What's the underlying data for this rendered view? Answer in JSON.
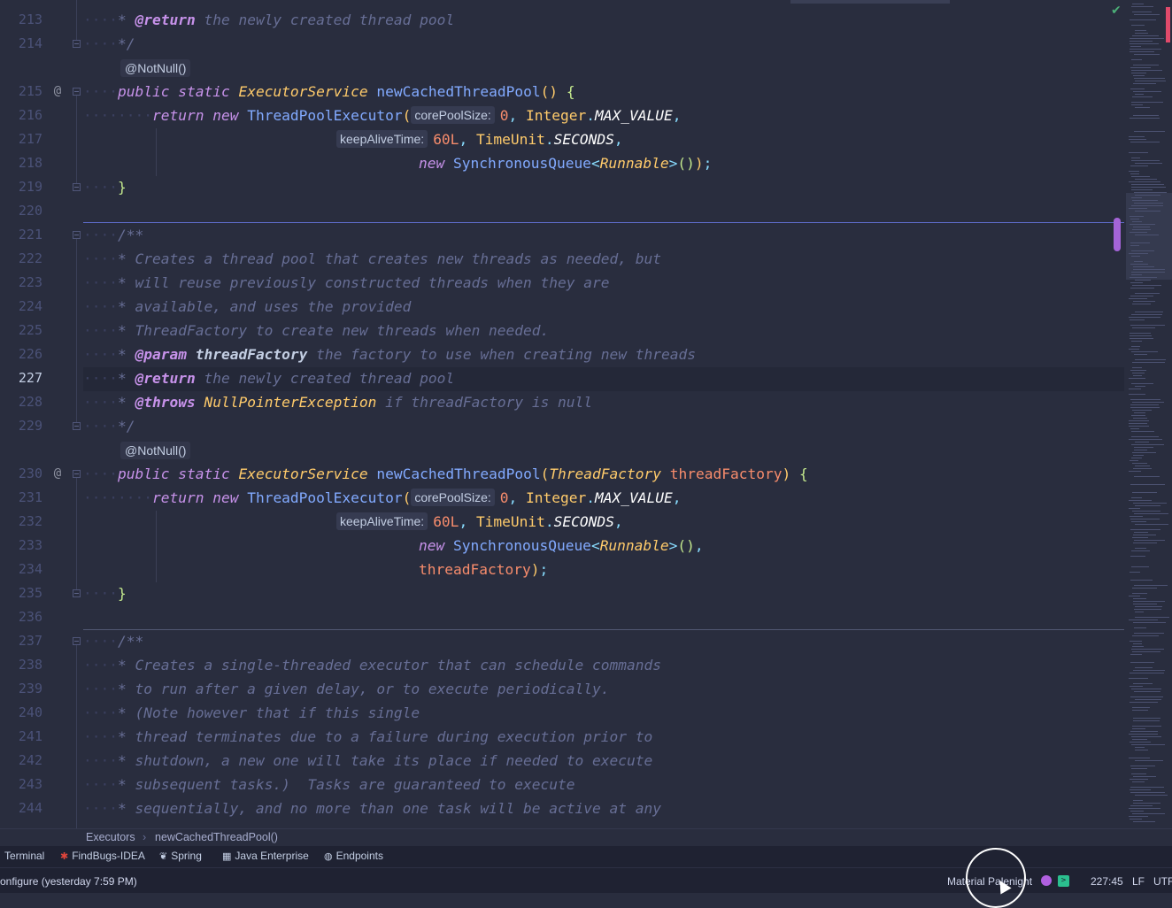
{
  "editor": {
    "current_line": "227",
    "lines": [
      {
        "n": "213",
        "text": "@return the newly created thread pool"
      },
      {
        "n": "214",
        "text": "*/"
      },
      {
        "n": "215",
        "text": "public static ExecutorService newCachedThreadPool() {"
      },
      {
        "n": "216",
        "text": "return new ThreadPoolExecutor(corePoolSize: 0, Integer.MAX_VALUE,"
      },
      {
        "n": "217",
        "text": "keepAliveTime: 60L, TimeUnit.SECONDS,"
      },
      {
        "n": "218",
        "text": "new SynchronousQueue<Runnable>());"
      },
      {
        "n": "219",
        "text": "}"
      },
      {
        "n": "220",
        "text": ""
      },
      {
        "n": "221",
        "text": "/**"
      },
      {
        "n": "222",
        "text": "* Creates a thread pool that creates new threads as needed, but"
      },
      {
        "n": "223",
        "text": "* will reuse previously constructed threads when they are"
      },
      {
        "n": "224",
        "text": "* available, and uses the provided"
      },
      {
        "n": "225",
        "text": "* ThreadFactory to create new threads when needed."
      },
      {
        "n": "226",
        "text": "* @param threadFactory the factory to use when creating new threads"
      },
      {
        "n": "227",
        "text": "* @return the newly created thread pool"
      },
      {
        "n": "228",
        "text": "* @throws NullPointerException if threadFactory is null"
      },
      {
        "n": "229",
        "text": "*/"
      },
      {
        "n": "230",
        "text": "public static ExecutorService newCachedThreadPool(ThreadFactory threadFactory) {"
      },
      {
        "n": "231",
        "text": "return new ThreadPoolExecutor(corePoolSize: 0, Integer.MAX_VALUE,"
      },
      {
        "n": "232",
        "text": "keepAliveTime: 60L, TimeUnit.SECONDS,"
      },
      {
        "n": "233",
        "text": "new SynchronousQueue<Runnable>(),"
      },
      {
        "n": "234",
        "text": "threadFactory);"
      },
      {
        "n": "235",
        "text": "}"
      },
      {
        "n": "236",
        "text": ""
      },
      {
        "n": "237",
        "text": "/**"
      },
      {
        "n": "238",
        "text": "* Creates a single-threaded executor that can schedule commands"
      },
      {
        "n": "239",
        "text": "* to run after a given delay, or to execute periodically."
      },
      {
        "n": "240",
        "text": "* (Note however that if this single"
      },
      {
        "n": "241",
        "text": "* thread terminates due to a failure during execution prior to"
      },
      {
        "n": "242",
        "text": "* shutdown, a new one will take its place if needed to execute"
      },
      {
        "n": "243",
        "text": "* subsequent tasks.)  Tasks are guaranteed to execute"
      },
      {
        "n": "244",
        "text": "* sequentially, and no more than one task will be active at any"
      }
    ],
    "tokens": {
      "star": "*",
      "comment_end": "*/",
      "comment_start": "/**",
      "at_return": "@return",
      "at_param": "@param",
      "at_throws": "@throws",
      "return_desc": "the newly created thread pool",
      "param_name": "threadFactory",
      "param_desc": "the factory to use when creating new threads",
      "throws_type": "NullPointerException",
      "throws_desc": "if threadFactory is null",
      "annotation": "@NotNull()",
      "kw_public": "public",
      "kw_static": "static",
      "kw_return": "return",
      "kw_new": "new",
      "type_executor_service": "ExecutorService",
      "method_name": "newCachedThreadPool",
      "class_tpe": "ThreadPoolExecutor",
      "hint_core": "corePoolSize:",
      "hint_keep": "keepAliveTime:",
      "num_zero": "0",
      "num_60l": "60L",
      "class_integer": "Integer",
      "const_max": "MAX_VALUE",
      "class_timeunit": "TimeUnit",
      "const_seconds": "SECONDS",
      "class_sq": "SynchronousQueue",
      "type_runnable": "Runnable",
      "type_thread_factory": "ThreadFactory",
      "param_thread_factory": "threadFactory",
      "brace_open": "{",
      "brace_close": "}",
      "paren_open": "(",
      "paren_close": ")",
      "paren_pair": "()",
      "lt": "<",
      "gt": ">",
      "comma": ",",
      "dot": ".",
      "semicolon": ";",
      "doc_222": "Creates a thread pool that creates new threads as needed, but",
      "doc_223": "will reuse previously constructed threads when they are",
      "doc_224": "available, and uses the provided",
      "doc_225": "ThreadFactory to create new threads when needed.",
      "doc_238": "Creates a single-threaded executor that can schedule commands",
      "doc_239": "to run after a given delay, or to execute periodically.",
      "doc_240": "(Note however that if this single",
      "doc_241": "thread terminates due to a failure during execution prior to",
      "doc_242": "shutdown, a new one will take its place if needed to execute",
      "doc_243": "subsequent tasks.)  Tasks are guaranteed to execute",
      "doc_244": "sequentially, and no more than one task will be active at any"
    },
    "gutter_icon": "@"
  },
  "breadcrumb": {
    "items": [
      "Executors",
      "newCachedThreadPool()"
    ],
    "separator": "›"
  },
  "toolbar": {
    "items": [
      {
        "label": "Terminal",
        "icon": "terminal-icon"
      },
      {
        "label": "FindBugs-IDEA",
        "icon": "findbugs-icon"
      },
      {
        "label": "Spring",
        "icon": "spring-leaf-icon"
      },
      {
        "label": "Java Enterprise",
        "icon": "java-enterprise-icon"
      },
      {
        "label": "Endpoints",
        "icon": "endpoints-icon"
      }
    ]
  },
  "statusbar": {
    "message": "onfigure (yesterday 7:59 PM)",
    "theme": "Material Palenight",
    "position": "227:45",
    "line_separator": "LF",
    "encoding": "UTF"
  },
  "colors": {
    "background": "#292d3e",
    "keyword": "#c792ea",
    "type": "#ffcb6b",
    "function": "#82aaff",
    "number": "#f78c6c",
    "comment": "#676e95",
    "accent": "#a464d8"
  }
}
